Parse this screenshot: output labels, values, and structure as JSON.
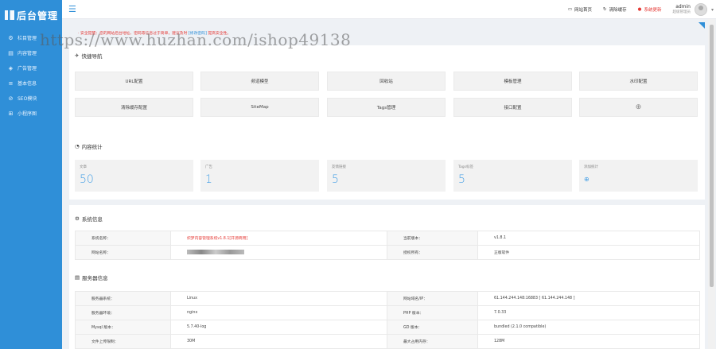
{
  "sidebar": {
    "logo": "后台管理",
    "items": [
      {
        "icon": "gear-icon",
        "glyph": "⚙",
        "label": "栏目管理"
      },
      {
        "icon": "document-icon",
        "glyph": "▤",
        "label": "内容管理"
      },
      {
        "icon": "megaphone-icon",
        "glyph": "◈",
        "label": "广告管理"
      },
      {
        "icon": "sliders-icon",
        "glyph": "≡",
        "label": "基本信息"
      },
      {
        "icon": "seo-icon",
        "glyph": "⊘",
        "label": "SEO模块"
      },
      {
        "icon": "grid-icon",
        "glyph": "⊞",
        "label": "小程序图"
      }
    ]
  },
  "topbar": {
    "site_home": "网站首页",
    "clear_cache": "清除缓存",
    "system_update": "系统更新",
    "user_name": "admin",
    "user_role": "超级管理员"
  },
  "notice": {
    "prefix": "· 安全提醒：您的网站后台地址、密码等信息过于简单，建议及时",
    "link": "[修改密码]",
    "suffix": "提高安全性。"
  },
  "watermark": "https://www.huzhan.com/ishop49138",
  "quick_nav": {
    "title": "快捷导航",
    "items": [
      "URL配置",
      "频道模型",
      "回收站",
      "模板管理",
      "水印配置",
      "清除缓存配置",
      "SiteMap",
      "Tags管理",
      "接口配置"
    ]
  },
  "content_stats": {
    "title": "内容统计",
    "items": [
      {
        "label": "文章",
        "value": "50"
      },
      {
        "label": "广告",
        "value": "1"
      },
      {
        "label": "友情链接",
        "value": "5"
      },
      {
        "label": "Tags标签",
        "value": "5"
      },
      {
        "label": "添加统计",
        "value": "⊕"
      }
    ]
  },
  "system_info": {
    "title": "系统信息",
    "rows": [
      {
        "k1": "系统名称：",
        "v1": "织梦内容管理系统v1.8.1[开源商用]",
        "k2": "当前版本：",
        "v2": "v1.8.1"
      },
      {
        "k1": "网站名称：",
        "v1": "",
        "k2": "授权所有：",
        "v2": "正版软件"
      }
    ]
  },
  "server_info": {
    "title": "服务器信息",
    "rows": [
      {
        "k1": "服务器系统：",
        "v1": "Linux",
        "k2": "网站域名/IP：",
        "v2": "61.144.244.148:16883 [ 61.144.244.148 ]"
      },
      {
        "k1": "服务器环境：",
        "v1": "nginx",
        "k2": "PHP 版本：",
        "v2": "7.0.33"
      },
      {
        "k1": "Mysql 版本：",
        "v1": "5.7.40-log",
        "k2": "GD 版本：",
        "v2": "bundled (2.1.0 compatible)"
      },
      {
        "k1": "文件上传限制：",
        "v1": "30M",
        "k2": "最大占用内存：",
        "v2": "128M"
      }
    ]
  },
  "colors": {
    "accent": "#2f8fd8",
    "alert": "#e53935",
    "stat_value": "#4aa2e6"
  }
}
